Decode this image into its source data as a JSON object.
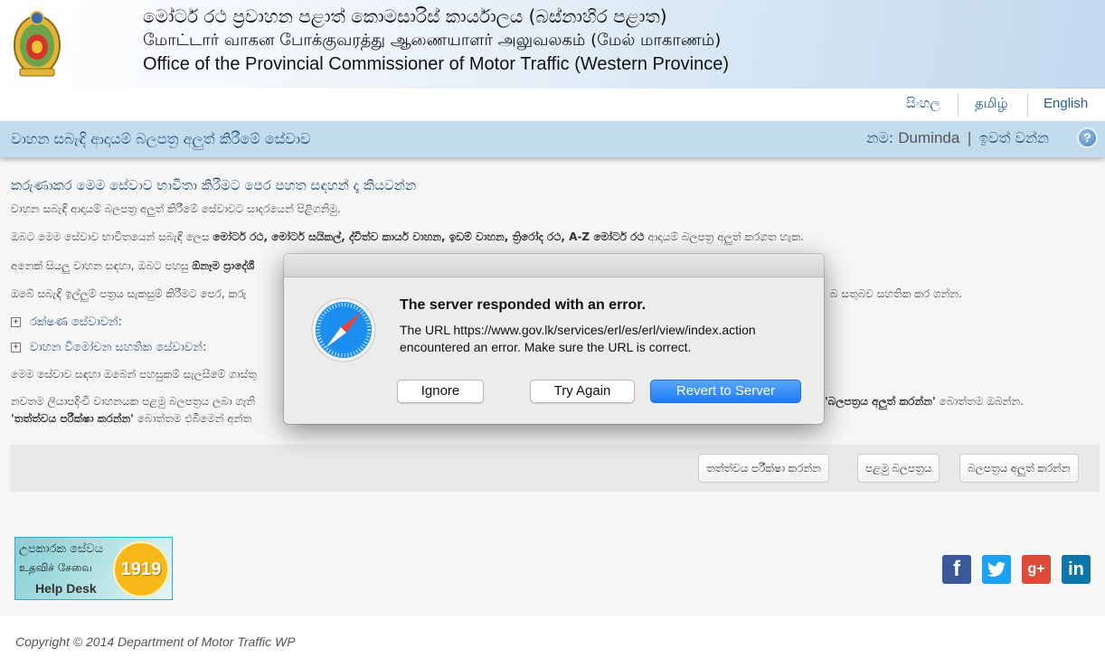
{
  "header": {
    "title_sinhala": "මෝටර් රථ ප්‍රවාහන පළාත් කොමසාරිස් කාර්යාලය (බස්නාහිර පළාත)",
    "title_tamil": "மோட்டார் வாகன போக்குவரத்து ஆணையாளர் அலுவலகம் (மேல் மாகாணம்)",
    "title_english": "Office of the Provincial Commissioner of Motor Traffic (Western Province)",
    "logo_icon": "sri-lanka-emblem-icon"
  },
  "languages": [
    {
      "label": "සිංහල"
    },
    {
      "label": "தமிழ்"
    },
    {
      "label": "English"
    }
  ],
  "service_bar": {
    "title": "වාහන සබැඳි ආදායම් බලපත්‍ර අලුත් කිරීමේ සේවාව",
    "name_label": "නම:",
    "user_name": "Duminda",
    "separator": "|",
    "logout": "ඉවත් වන්න",
    "help_icon": "?"
  },
  "content": {
    "intro_title": "කරුණාකර මෙම සේවාව භාවිතා කිරීමට පෙර පහත සඳහන් දෑ කියවන්න",
    "welcome": "වාහන සබැඳි ආදායම් බලපත්‍ර අලුත් කිරීමේ සේවාවට සාදරයෙන් පිළිගනිමු.",
    "para_vehicles_pre": "ඔබට මෙම සේවාව භාවිතයෙන් සබැඳි ලෙස ",
    "para_vehicles_bold": "මෝටර් රථ, මෝටර් සයිකල්, ද්විත්ව කාර්ය වාහන, ඉඩම් වාහන, ත්‍රිරෝද රථ, A-Z මෝටර් රථ",
    "para_vehicles_post": " ආදායම් බලපත්‍ර අලුත් කරගත හැක.",
    "para_other_pre": "අනෙක් සියලු වාහන සඳහා, ඔබට පහසු ",
    "para_other_bold": "ඕනෑම ප්‍රාදේශී",
    "para_check": "ඔබේ සබැඳි ඉල්ලුම් පත්‍රය සැකසුම් කිරීමට පෙර, කරු",
    "para_check_end": "බ සතුබව සහතික කර ගන්න.",
    "expanders": [
      {
        "label": "රක්ෂණ සේවාවන්:"
      },
      {
        "label": "වාහන විමෝචන සහතික සේවාවන්:"
      }
    ],
    "para_fee": "මෙම සේවාව සඳහා ඔබෙන් පහසුකම් සැලසීමේ ගාස්තු",
    "para_new_1": "නවතම ලියාපදිංචි වාහනයක පළමු බලපත්‍රය ලබා ගැනි",
    "para_new_1_end_bold": "'බලපත්‍රය අලුත් කරන්න'",
    "para_new_1_end": " බොත්තම ඔබන්න.",
    "para_new_2_bold": "'තත්ත්වය පරීක්ෂා කරන්න'",
    "para_new_2": " බොත්තම එබීමෙන් අන්ත"
  },
  "actions": {
    "check_status": "තත්ත්වය පරීක්ෂා කරන්න",
    "first_license": "පළමු බලපත්‍රය",
    "renew_license": "බලපත්‍රය අලුත් කරන්න"
  },
  "help_desk": {
    "sinhala": "උපකාරක සේවය",
    "tamil": "உதவிச் சேவை",
    "english": "Help Desk",
    "number": "1919"
  },
  "social": [
    {
      "name": "facebook-icon",
      "glyph": "f",
      "color": "#3b5998"
    },
    {
      "name": "twitter-icon",
      "glyph": "🐦",
      "color": "#1da1f2"
    },
    {
      "name": "google-plus-icon",
      "glyph": "g+",
      "color": "#dd4b39"
    },
    {
      "name": "linkedin-icon",
      "glyph": "in",
      "color": "#0e76a8"
    }
  ],
  "footer": {
    "copyright": "Copyright © 2014 Department of Motor Traffic WP"
  },
  "dialog": {
    "icon": "safari-compass-icon",
    "title": "The server responded with an error.",
    "message": "The URL https://www.gov.lk/services/erl/es/erl/view/index.action encountered an error. Make sure the URL is correct.",
    "buttons": {
      "ignore": "Ignore",
      "try_again": "Try Again",
      "revert": "Revert to Server"
    },
    "primary_color": "#1f7cf5"
  }
}
